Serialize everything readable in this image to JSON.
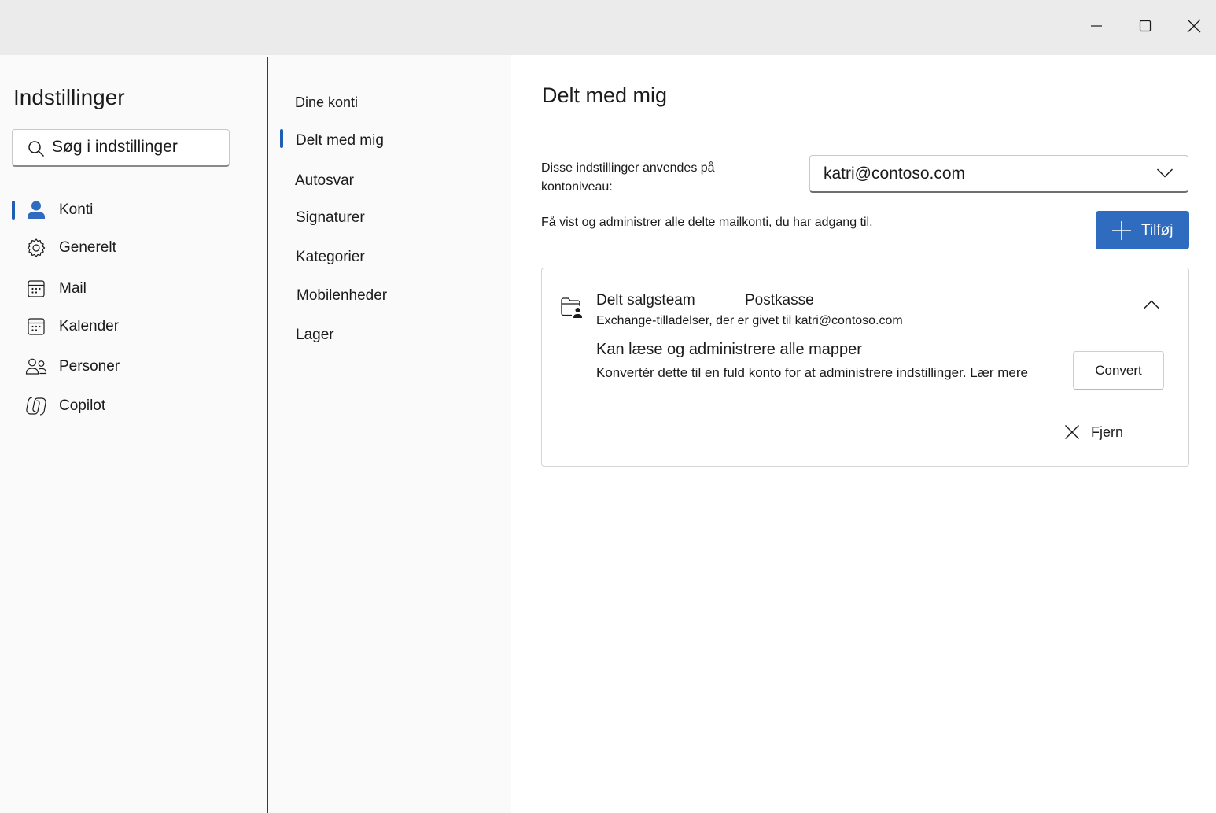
{
  "window": {
    "minimize_icon": "minimize-icon",
    "maximize_icon": "maximize-icon",
    "close_icon": "close-icon"
  },
  "sidebar": {
    "title": "Indstillinger",
    "search": {
      "placeholder": "Søg i indstillinger",
      "icon": "search-icon"
    },
    "items": [
      {
        "label": "Konti",
        "icon": "person-icon",
        "selected": true
      },
      {
        "label": "Generelt",
        "icon": "gear-icon",
        "selected": false
      },
      {
        "label": "Mail",
        "icon": "mail-grid-icon",
        "selected": false
      },
      {
        "label": "Kalender",
        "icon": "calendar-icon",
        "selected": false
      },
      {
        "label": "Personer",
        "icon": "people-icon",
        "selected": false
      },
      {
        "label": "Copilot",
        "icon": "copilot-icon",
        "selected": false
      }
    ]
  },
  "subnav": {
    "items": [
      {
        "label": "Dine konti",
        "selected": false
      },
      {
        "label": "Delt med mig",
        "selected": true
      },
      {
        "label": "Autosvar",
        "selected": false
      },
      {
        "label": "Signaturer",
        "selected": false
      },
      {
        "label": "Kategorier",
        "selected": false
      },
      {
        "label": "Mobilenheder",
        "selected": false
      },
      {
        "label": "Lager",
        "selected": false
      }
    ]
  },
  "main": {
    "title": "Delt med mig",
    "applies_label": "Disse indstillinger anvendes på kontoniveau:",
    "account_select": {
      "value": "katri@contoso.com",
      "icon": "chevron-down-icon"
    },
    "description": "Få vist og administrer alle delte mailkonti, du har adgang til.",
    "add_button": {
      "label": "Tilføj",
      "icon": "plus-icon"
    },
    "shared_account": {
      "name": "Delt salgsteam",
      "type": "Postkasse",
      "permissions_note": "Exchange-tilladelser, der er givet til katri@contoso.com",
      "permission_title": "Kan læse og administrere alle mapper",
      "convert_text": "Konvertér dette til en fuld konto for at administrere indstillinger. Lær mere",
      "convert_button": "Convert",
      "remove_button": "Fjern",
      "icons": {
        "folder": "shared-folder-icon",
        "collapse": "chevron-up-icon",
        "remove": "close-icon"
      },
      "accent": "#2f6bbf"
    }
  },
  "colors": {
    "accent": "#1f5eb5",
    "button_primary": "#2f6bbf",
    "titlebar": "#ebebeb",
    "pane": "#fafafa"
  }
}
